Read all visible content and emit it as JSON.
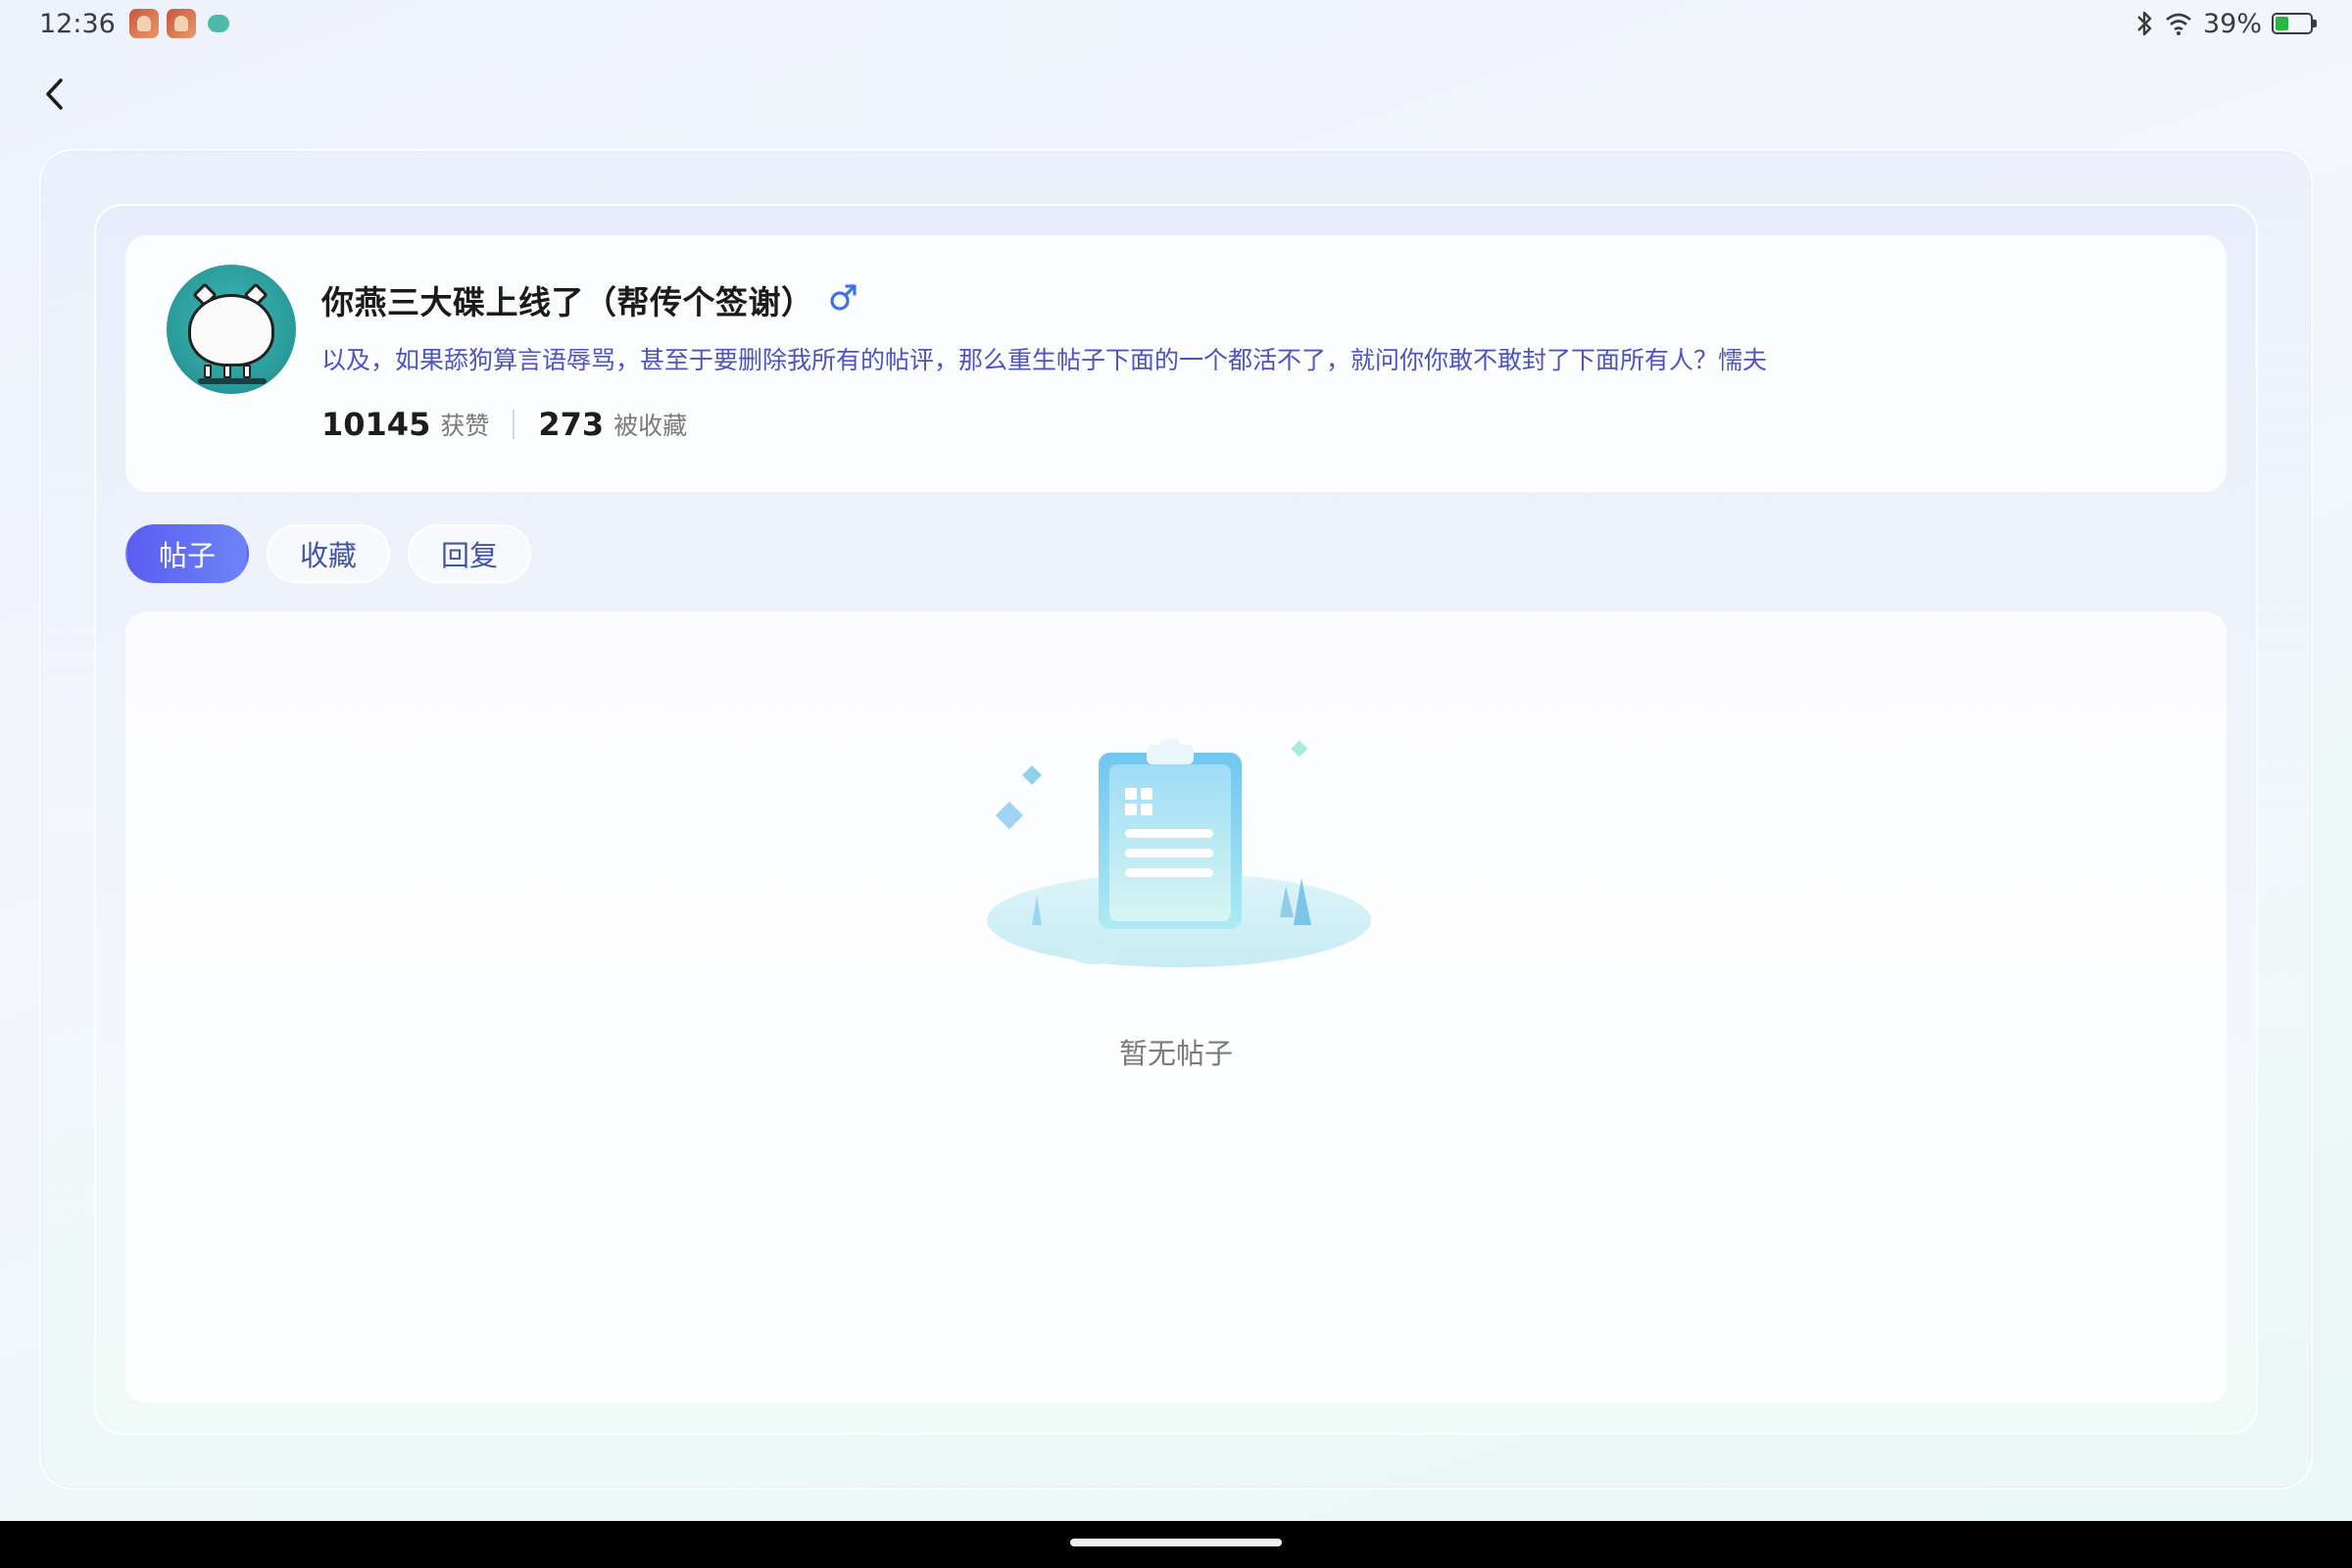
{
  "status_bar": {
    "time": "12:36",
    "battery_percent": "39%",
    "battery_level": 0.39,
    "icons": [
      "app-notification-icon",
      "app-notification-icon",
      "app-notification-icon",
      "bluetooth-icon",
      "wifi-icon",
      "battery-icon"
    ]
  },
  "header": {
    "back_icon": "chevron-left-icon"
  },
  "profile": {
    "username": "你燕三大碟上线了（帮传个签谢）",
    "gender_icon": "male-icon",
    "bio": "以及，如果舔狗算言语辱骂，甚至于要删除我所有的帖评，那么重生帖子下面的一个都活不了，就问你你敢不敢封了下面所有人？懦夫",
    "stats": [
      {
        "value": "10145",
        "label": "获赞"
      },
      {
        "value": "273",
        "label": "被收藏"
      }
    ]
  },
  "tabs": [
    {
      "label": "帖子",
      "active": true
    },
    {
      "label": "收藏",
      "active": false
    },
    {
      "label": "回复",
      "active": false
    }
  ],
  "content": {
    "empty_text": "暂无帖子",
    "empty_icon": "empty-clipboard-icon"
  },
  "colors": {
    "accent": "#5a5df2",
    "bio_text": "#4e52c4",
    "gender_blue": "#3d74e0",
    "battery_green": "#2fb344"
  }
}
